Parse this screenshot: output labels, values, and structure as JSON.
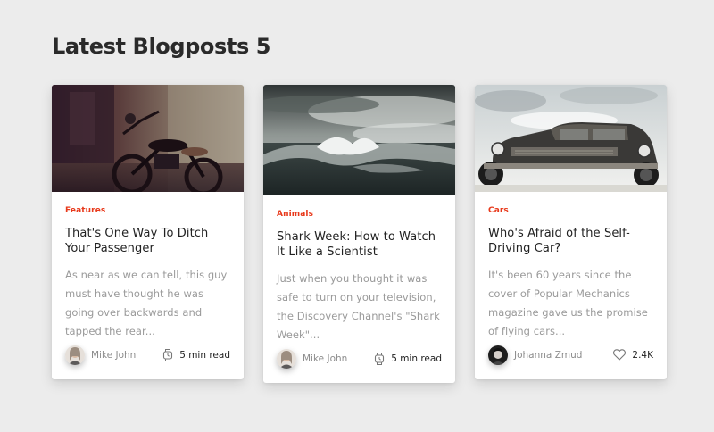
{
  "page": {
    "heading": "Latest Blogposts 5"
  },
  "cards": [
    {
      "category": "Features",
      "title": "That's One Way To Ditch Your Passenger",
      "excerpt": "As near as we can tell, this guy must have thought he was going over backwards and tapped the rear...",
      "author": "Mike John",
      "meta_icon": "watch-icon",
      "meta": "5 min read"
    },
    {
      "category": "Animals",
      "title": "Shark Week: How to Watch It Like a Scientist",
      "excerpt": "Just when you thought it was safe to turn on your television, the Discovery Channel's \"Shark Week\"...",
      "author": "Mike John",
      "meta_icon": "watch-icon",
      "meta": "5 min read"
    },
    {
      "category": "Cars",
      "title": "Who's Afraid of the Self-Driving Car?",
      "excerpt": "It's been 60 years since the cover of Popular Mechanics magazine gave us the promise of flying cars...",
      "author": "Johanna Zmud",
      "meta_icon": "heart-icon",
      "meta": "2.4K"
    }
  ],
  "colors": {
    "accent": "#e8391b",
    "background": "#ececec",
    "card": "#ffffff",
    "excerpt_text": "#9a9a9a"
  }
}
